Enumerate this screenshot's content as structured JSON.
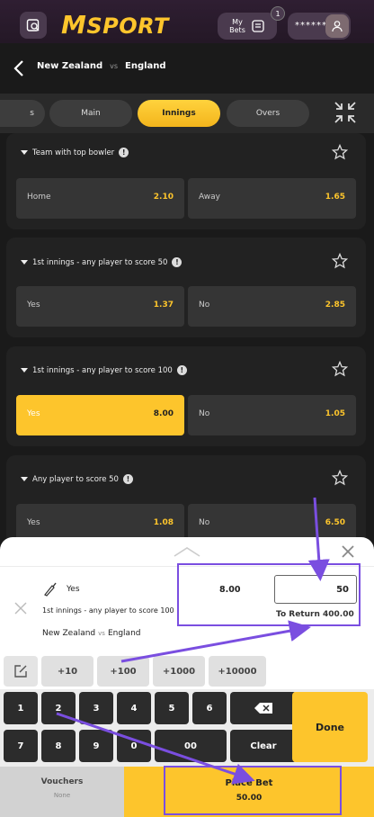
{
  "header": {
    "logo_text": "SPORT",
    "logo_m": "M",
    "my_bets_line1": "My",
    "my_bets_line2": "Bets",
    "my_bets_count": "1",
    "balance_masked": "******",
    "icons": {
      "menu": "ticket-search-icon",
      "bets": "receipt-icon",
      "user": "user-icon"
    }
  },
  "match": {
    "home": "New Zealand",
    "vs": "vs",
    "away": "England"
  },
  "tabs": [
    {
      "label": "s"
    },
    {
      "label": "Main"
    },
    {
      "label": "Innings",
      "active": true
    },
    {
      "label": "Overs"
    }
  ],
  "markets": [
    {
      "title": "Team with top bowler",
      "options": [
        {
          "name": "Home",
          "odds": "2.10"
        },
        {
          "name": "Away",
          "odds": "1.65"
        }
      ]
    },
    {
      "title": "1st innings - any player to score 50",
      "options": [
        {
          "name": "Yes",
          "odds": "1.37"
        },
        {
          "name": "No",
          "odds": "2.85"
        }
      ]
    },
    {
      "title": "1st innings - any player to score 100",
      "options": [
        {
          "name": "Yes",
          "odds": "8.00",
          "selected": true
        },
        {
          "name": "No",
          "odds": "1.05"
        }
      ]
    },
    {
      "title": "Any player to score 50",
      "options": [
        {
          "name": "Yes",
          "odds": "1.08"
        },
        {
          "name": "No",
          "odds": "6.50"
        }
      ]
    }
  ],
  "betslip": {
    "selection": "Yes",
    "market": "1st innings - any player to score 100",
    "match_home": "New Zealand",
    "match_vs": "vs",
    "match_away": "England",
    "odds": "8.00",
    "stake": "50",
    "to_return_label": "To Return",
    "to_return_value": "400.00",
    "quick_amounts": [
      "+10",
      "+100",
      "+1000",
      "+10000"
    ],
    "keys_row1": [
      "1",
      "2",
      "3",
      "4",
      "5",
      "6"
    ],
    "keys_row2": [
      "7",
      "8",
      "9",
      "0",
      "00",
      "Clear"
    ],
    "done_label": "Done",
    "vouchers_label": "Vouchers",
    "vouchers_value": "None",
    "place_bet_label": "Place Bet",
    "place_bet_value": "50.00"
  },
  "colors": {
    "accent": "#fdc52c",
    "header_bg": "#2f1e32",
    "annotation": "#7a4ee0"
  }
}
